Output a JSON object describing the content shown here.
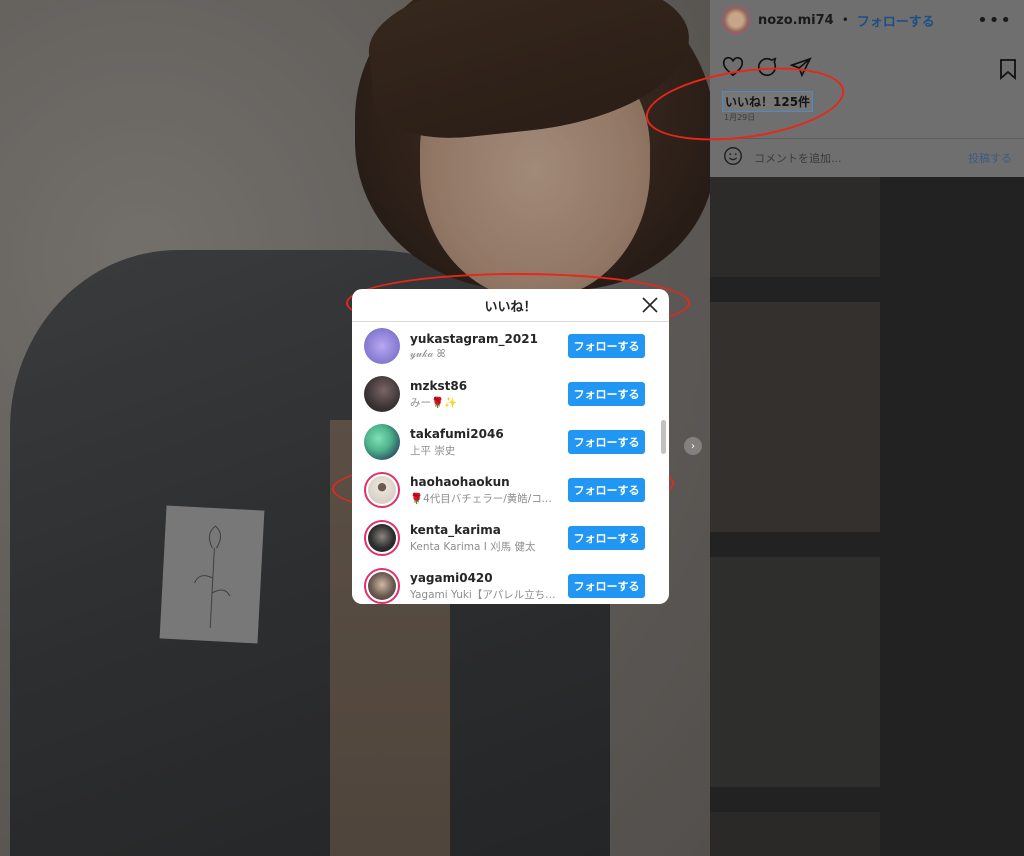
{
  "post": {
    "username": "nozo.mi74",
    "separator": "•",
    "follow_label": "フォローする",
    "likes_label": "いいね！125件",
    "date": "1月29日",
    "comment_placeholder": "コメントを追加...",
    "post_button": "投稿する"
  },
  "modal": {
    "title": "いいね！",
    "follow_button_label": "フォローする",
    "users": [
      {
        "username": "yukastagram_2021",
        "display_name": "𝓎𝓊𝓀𝒶 ꕤ",
        "avatar_color": "#8a7fd6",
        "ring": false
      },
      {
        "username": "mzkst86",
        "display_name": "みー🌹✨",
        "avatar_color": "#3a3334",
        "ring": false
      },
      {
        "username": "takafumi2046",
        "display_name": "上平 崇史",
        "avatar_color": "#4fb58c",
        "ring": false
      },
      {
        "username": "haohaohaokun",
        "display_name": "🌹4代目バチェラー/黄皓/コウ…",
        "avatar_color": "#e8e2da",
        "ring": true
      },
      {
        "username": "kenta_karima",
        "display_name": "Kenta Karima I 刈馬 健太",
        "avatar_color": "#2e2e2e",
        "ring": true
      },
      {
        "username": "yagami0420",
        "display_name": "Yagami Yuki【アパレル立ち…",
        "avatar_color": "#6b5a50",
        "ring": true
      }
    ]
  },
  "colors": {
    "accent_blue": "#2196f3",
    "annotation_red": "#e8261a",
    "story_ring": "#e1306c"
  }
}
